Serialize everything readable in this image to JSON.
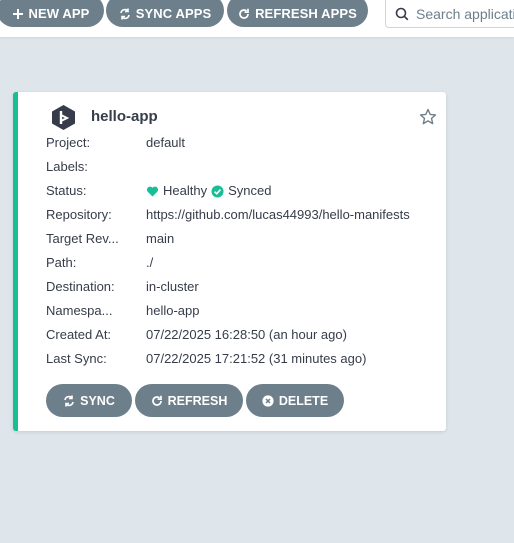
{
  "toolbar": {
    "new_app_label": "NEW APP",
    "sync_apps_label": "SYNC APPS",
    "refresh_apps_label": "REFRESH APPS",
    "search_placeholder": "Search applications..."
  },
  "app": {
    "name": "hello-app",
    "rows": [
      {
        "label": "Project:",
        "value": "default"
      },
      {
        "label": "Labels:",
        "value": ""
      },
      {
        "label": "Status:",
        "health": "Healthy",
        "sync": "Synced"
      },
      {
        "label": "Repository:",
        "value": "https://github.com/lucas44993/hello-manifests"
      },
      {
        "label": "Target Rev...",
        "value": "main"
      },
      {
        "label": "Path:",
        "value": "./"
      },
      {
        "label": "Destination:",
        "value": "in-cluster"
      },
      {
        "label": "Namespa...",
        "value": "hello-app"
      },
      {
        "label": "Created At:",
        "value": "07/22/2025 16:28:50  (an hour ago)"
      },
      {
        "label": "Last Sync:",
        "value": "07/22/2025 17:21:52  (31 minutes ago)"
      }
    ],
    "actions": {
      "sync_label": "SYNC",
      "refresh_label": "REFRESH",
      "delete_label": "DELETE"
    }
  },
  "colors": {
    "accent_green": "#18be94",
    "button_gray": "#6d7f8b",
    "background": "#dee6eb"
  },
  "icons": [
    "plus-icon",
    "sync-icon",
    "refresh-icon",
    "search-icon",
    "argo-logo-icon",
    "star-icon",
    "heart-icon",
    "check-circle-icon",
    "close-circle-icon"
  ]
}
